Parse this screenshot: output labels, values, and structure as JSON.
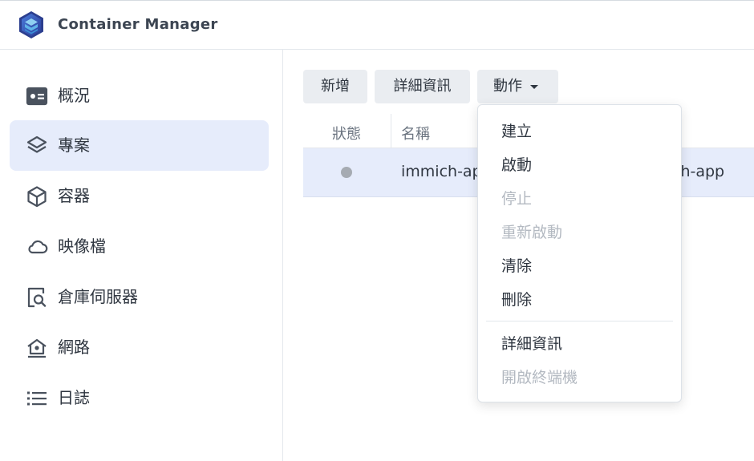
{
  "app": {
    "title": "Container Manager"
  },
  "sidebar": {
    "items": [
      {
        "label": "概況",
        "icon": "overview-icon",
        "active": false
      },
      {
        "label": "專案",
        "icon": "layers-icon",
        "active": true
      },
      {
        "label": "容器",
        "icon": "cube-icon",
        "active": false
      },
      {
        "label": "映像檔",
        "icon": "cloud-icon",
        "active": false
      },
      {
        "label": "倉庫伺服器",
        "icon": "registry-search-icon",
        "active": false
      },
      {
        "label": "網路",
        "icon": "network-home-icon",
        "active": false
      },
      {
        "label": "日誌",
        "icon": "list-icon",
        "active": false
      }
    ]
  },
  "toolbar": {
    "new_label": "新增",
    "detail_label": "詳細資訊",
    "action_label": "動作"
  },
  "table": {
    "headers": {
      "status": "狀態",
      "name": "名稱"
    },
    "rows": [
      {
        "status": "stopped",
        "name": "immich-ap",
        "path": "ch-app"
      }
    ]
  },
  "action_menu": {
    "items": [
      {
        "label": "建立",
        "enabled": true
      },
      {
        "label": "啟動",
        "enabled": true
      },
      {
        "label": "停止",
        "enabled": false
      },
      {
        "label": "重新啟動",
        "enabled": false
      },
      {
        "label": "清除",
        "enabled": true
      },
      {
        "label": "刪除",
        "enabled": true
      },
      {
        "label": "詳細資訊",
        "enabled": true
      },
      {
        "label": "開啟終端機",
        "enabled": false
      }
    ]
  },
  "colors": {
    "accent_bg": "#e6ecfb",
    "button_bg": "#eaedf1",
    "disabled_text": "#b3b9c1",
    "status_stopped": "#a6abb2"
  }
}
